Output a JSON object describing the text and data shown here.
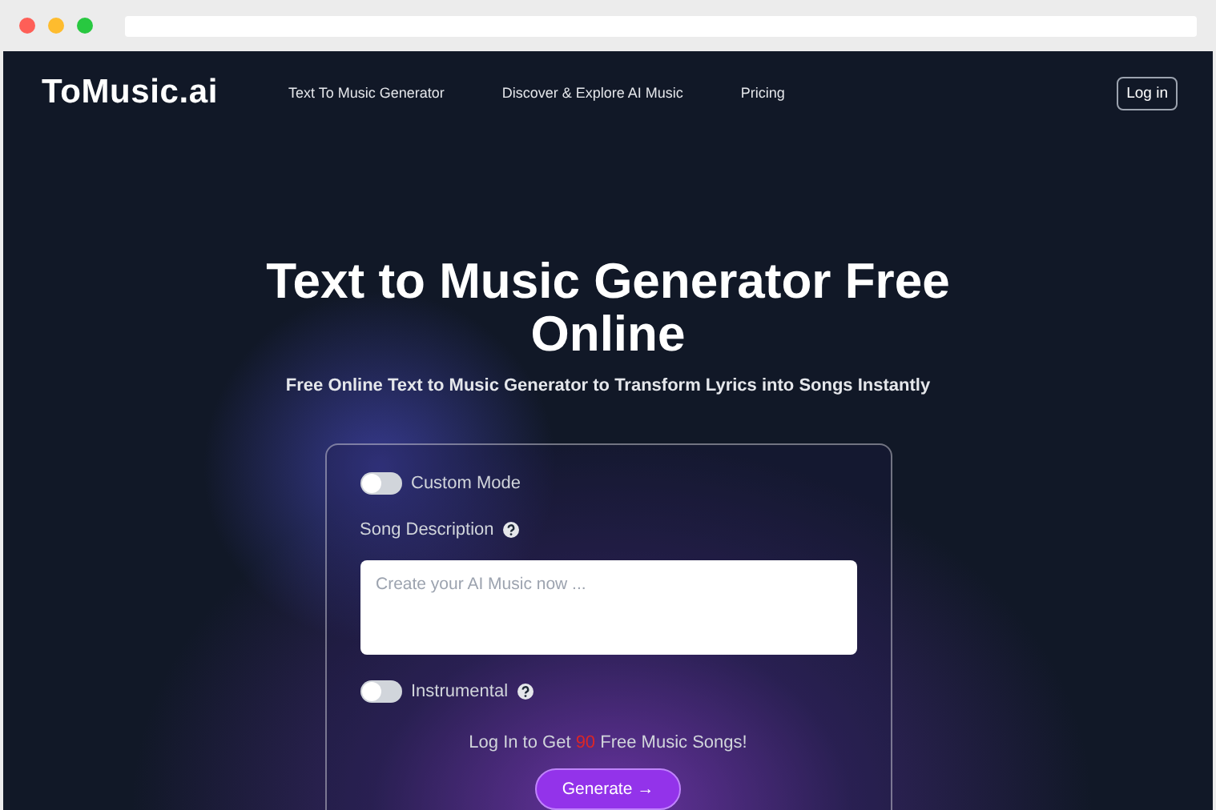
{
  "browser": {
    "buttons": [
      {
        "color": "#fe5f57"
      },
      {
        "color": "#febc2e"
      },
      {
        "color": "#28c840"
      }
    ]
  },
  "nav": {
    "logo": "ToMusic.ai",
    "links": [
      "Text To Music Generator",
      "Discover & Explore AI Music",
      "Pricing"
    ],
    "login": "Log in"
  },
  "hero": {
    "title": "Text to Music Generator Free Online",
    "subtitle": "Free Online Text to Music Generator to Transform Lyrics into Songs Instantly"
  },
  "form": {
    "custom_mode": {
      "label": "Custom Mode",
      "on": false
    },
    "description": {
      "label": "Song Description",
      "placeholder": "Create your AI Music now ..."
    },
    "instrumental": {
      "label": "Instrumental",
      "on": false
    },
    "promo": {
      "before": "Log In to Get",
      "count": "90",
      "after": "Free Music Songs!"
    },
    "generate": "Generate →"
  }
}
